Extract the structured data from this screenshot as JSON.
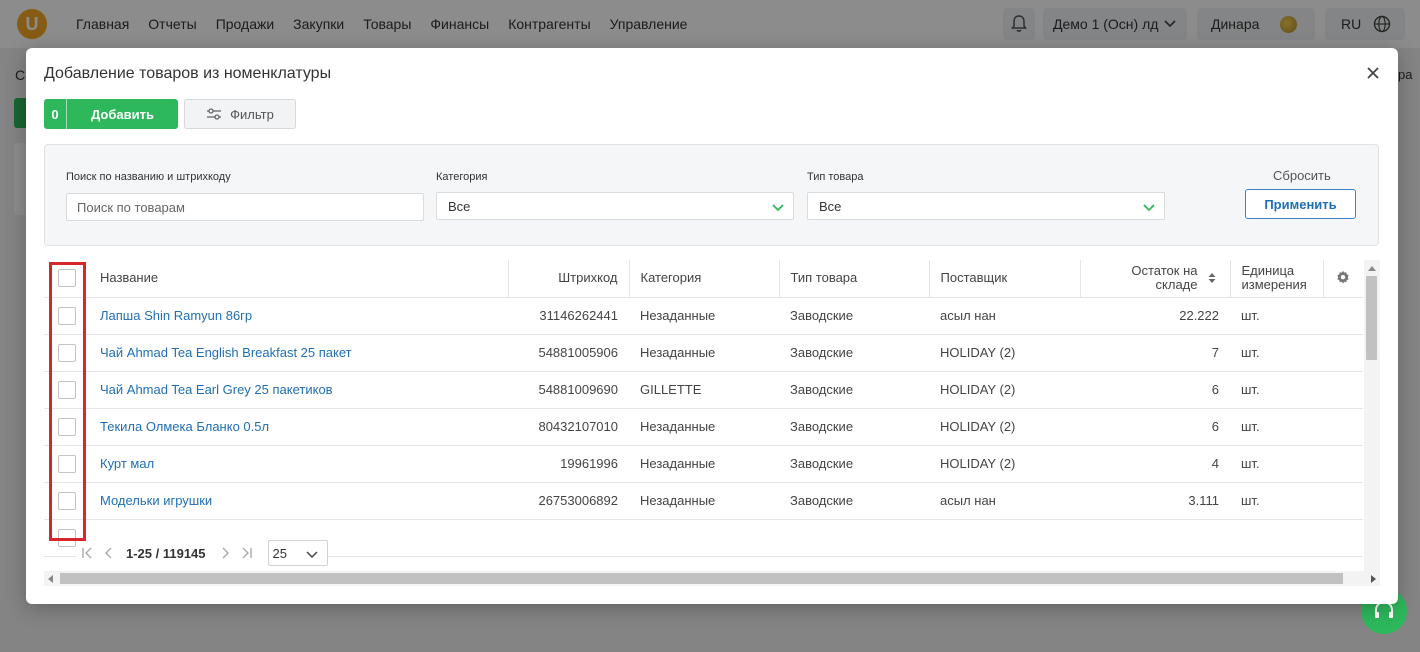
{
  "app": {
    "logo": "U",
    "nav": [
      "Главная",
      "Отчеты",
      "Продажи",
      "Закупки",
      "Товары",
      "Финансы",
      "Контрагенты",
      "Управление"
    ],
    "company": "Демо 1 (Осн) лд",
    "user": "Динара",
    "language": "RU",
    "bg_left_fragment": "С",
    "bg_right_fragment": "ра"
  },
  "modal": {
    "title": "Добавление товаров из номенклатуры",
    "add_count": "0",
    "add_label": "Добавить",
    "filter_label": "Фильтр"
  },
  "filters": {
    "search_label": "Поиск по названию и штрихкоду",
    "search_placeholder": "Поиск по товарам",
    "search_value": "",
    "category_label": "Категория",
    "category_value": "Все",
    "type_label": "Тип товара",
    "type_value": "Все",
    "reset_label": "Сбросить",
    "apply_label": "Применить"
  },
  "table": {
    "columns": {
      "name": "Название",
      "barcode": "Штрихкод",
      "category": "Категория",
      "type": "Тип товара",
      "supplier": "Поставщик",
      "stock": "Остаток на складе",
      "unit": "Единица измерения"
    },
    "rows": [
      {
        "name": "Лапша Shin Ramyun 86гр",
        "barcode": "31146262441",
        "category": "Незаданные",
        "type": "Заводские",
        "supplier": "асыл нан",
        "stock": "22.222",
        "unit": "шт."
      },
      {
        "name": "Чай Ahmad Tea English Breakfast 25 пакет",
        "barcode": "54881005906",
        "category": "Незаданные",
        "type": "Заводские",
        "supplier": "HOLIDAY (2)",
        "stock": "7",
        "unit": "шт."
      },
      {
        "name": "Чай Ahmad Tea Earl Grey 25 пакетиков",
        "barcode": "54881009690",
        "category": "GILLETTE",
        "type": "Заводские",
        "supplier": "HOLIDAY (2)",
        "stock": "6",
        "unit": "шт."
      },
      {
        "name": "Текила Олмека Бланко 0.5л",
        "barcode": "80432107010",
        "category": "Незаданные",
        "type": "Заводские",
        "supplier": "HOLIDAY (2)",
        "stock": "6",
        "unit": "шт."
      },
      {
        "name": "Курт мал",
        "barcode": "19961996",
        "category": "Незаданные",
        "type": "Заводские",
        "supplier": "HOLIDAY (2)",
        "stock": "4",
        "unit": "шт."
      },
      {
        "name": "Модельки игрушки",
        "barcode": "26753006892",
        "category": "Незаданные",
        "type": "Заводские",
        "supplier": "асыл нан",
        "stock": "3.111",
        "unit": "шт."
      },
      {
        "name": "",
        "barcode": "",
        "category": "",
        "type": "",
        "supplier": "",
        "stock": "",
        "unit": ""
      }
    ]
  },
  "pagination": {
    "range": "1-25 / 119145",
    "page_size": "25"
  },
  "colors": {
    "accent_green": "#2eb85c",
    "link_blue": "#1f6fb5",
    "highlight_red": "#d9262c"
  }
}
